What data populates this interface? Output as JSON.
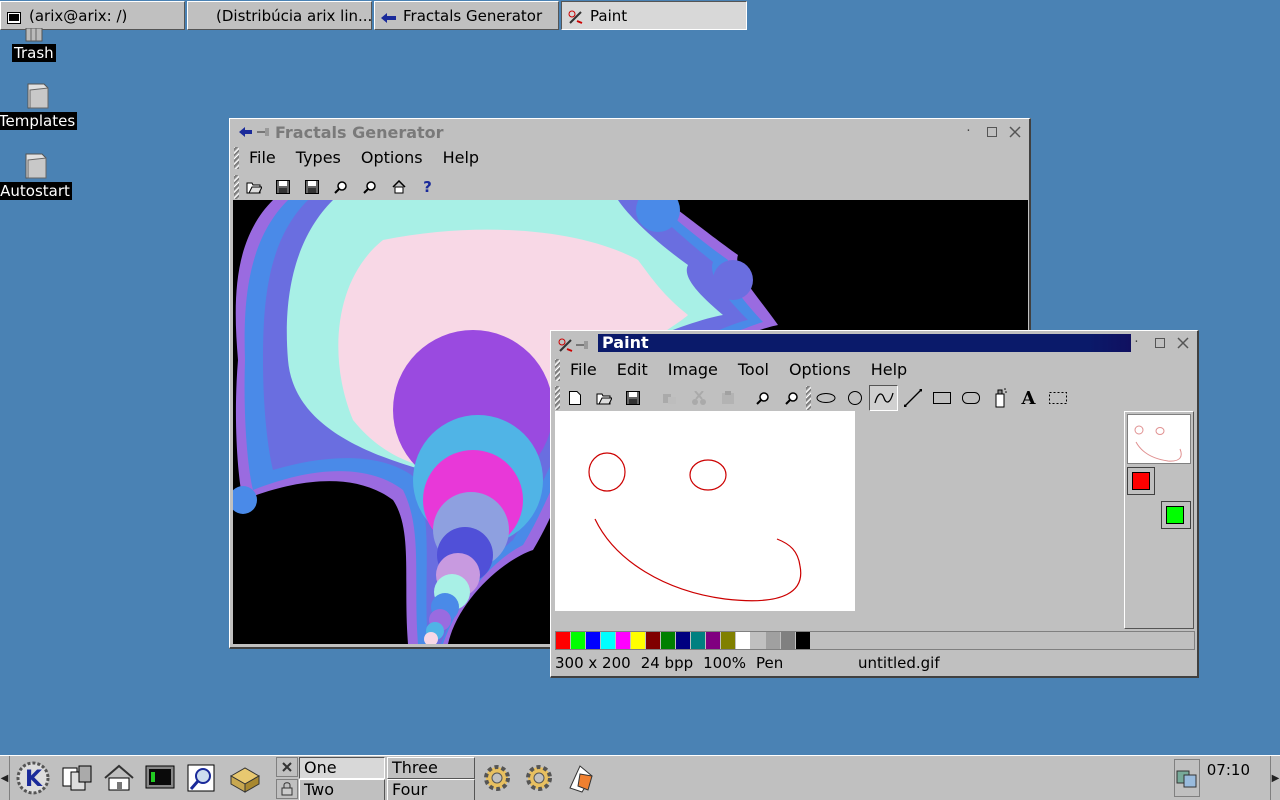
{
  "taskbar": {
    "tasks": [
      {
        "label": "(arix@arix: /)",
        "icon": "terminal-icon"
      },
      {
        "label": "(Distribúcia arix lin...",
        "icon": ""
      },
      {
        "label": "Fractals Generator",
        "icon": "fractal-app-icon"
      },
      {
        "label": "Paint",
        "icon": "paint-app-icon"
      }
    ]
  },
  "desktop": {
    "icons": [
      {
        "label": "Trash",
        "icon": "trash-icon"
      },
      {
        "label": "Templates",
        "icon": "folder-icon"
      },
      {
        "label": "Autostart",
        "icon": "folder-icon"
      }
    ]
  },
  "fractals_window": {
    "title": "Fractals Generator",
    "menu": [
      "File",
      "Types",
      "Options",
      "Help"
    ],
    "menu_underline": [
      "F",
      "T",
      "O",
      "H"
    ],
    "toolbar": [
      "open-icon",
      "save-icon",
      "save-as-icon",
      "zoom-in-icon",
      "zoom-out-icon",
      "home-icon",
      "help-icon"
    ],
    "palette_colors": [
      "#000000",
      "#9a6be0",
      "#4a8ae8",
      "#6a6ee0",
      "#a8f0e6",
      "#f8d8e6",
      "#9a4ae0",
      "#50b4e6",
      "#e838d8",
      "#8ea0e0",
      "#5050d8",
      "#c89ae0"
    ]
  },
  "paint_window": {
    "title": "Paint",
    "menu": [
      "File",
      "Edit",
      "Image",
      "Tool",
      "Options",
      "Help"
    ],
    "menu_underline": [
      "F",
      "E",
      "I",
      "T",
      "O",
      "H"
    ],
    "toolbar": [
      "new-icon",
      "open-icon",
      "save-icon",
      "cut-icon",
      "copy-icon",
      "paste-icon",
      "zoom-in-icon",
      "zoom-out-icon",
      "ellipse-icon",
      "circle-icon",
      "pen-icon",
      "line-icon",
      "rectangle-icon",
      "rounded-rect-icon",
      "spray-icon",
      "text-icon",
      "selection-icon"
    ],
    "foreground_color": "#ff0000",
    "background_color": "#00ff00",
    "palette": [
      "#ff0000",
      "#00ff00",
      "#0000ff",
      "#00ffff",
      "#ff00ff",
      "#ffff00",
      "#800000",
      "#008000",
      "#000080",
      "#008080",
      "#800080",
      "#808000",
      "#ffffff",
      "#c0c0c0",
      "#a0a0a0",
      "#808080",
      "#000000"
    ],
    "status": {
      "size": "300 x 200",
      "depth": "24 bpp",
      "zoom": "100%",
      "tool": "Pen",
      "filename": "untitled.gif"
    }
  },
  "panel": {
    "desktops": [
      "One",
      "Two",
      "Three",
      "Four"
    ],
    "active_desktop": "One",
    "clock": "07:10"
  }
}
